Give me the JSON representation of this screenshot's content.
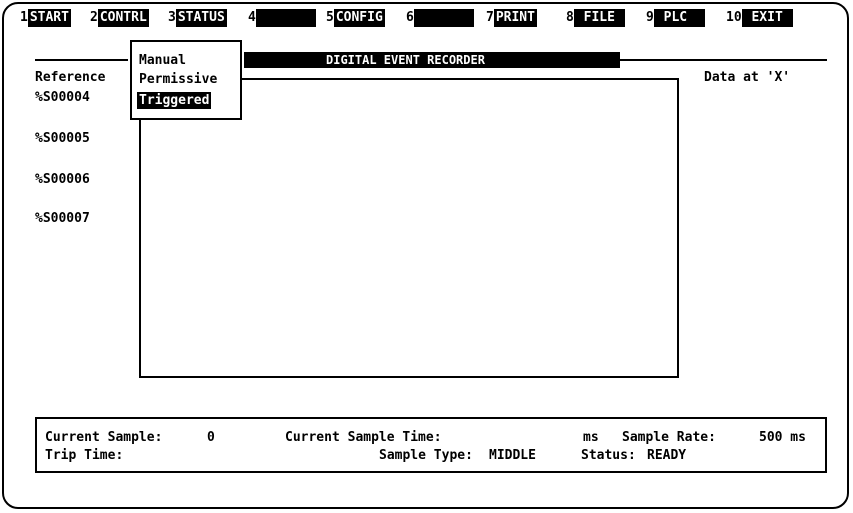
{
  "fkeys": [
    {
      "num": "1",
      "label": "START"
    },
    {
      "num": "2",
      "label": "CONTRL"
    },
    {
      "num": "3",
      "label": "STATUS"
    },
    {
      "num": "4",
      "label": "      "
    },
    {
      "num": "5",
      "label": "CONFIG"
    },
    {
      "num": "6",
      "label": "      "
    },
    {
      "num": "7",
      "label": "PRINT"
    },
    {
      "num": "8",
      "label": " FILE "
    },
    {
      "num": "9",
      "label": " PLC  "
    },
    {
      "num": "10",
      "label": " EXIT "
    }
  ],
  "title": "DIGITAL EVENT RECORDER",
  "reference_header": "Reference",
  "data_header": "Data at 'X'",
  "references": [
    "%S00004",
    "%S00005",
    "%S00006",
    "%S00007"
  ],
  "menu": {
    "items": [
      "Manual",
      "Permissive",
      "Triggered"
    ],
    "selected": "Triggered"
  },
  "status": {
    "current_sample_label": "Current Sample:",
    "current_sample_value": "0",
    "current_sample_time_label": "Current Sample Time:",
    "current_sample_time_unit": "ms",
    "sample_rate_label": "Sample Rate:",
    "sample_rate_value": "500 ms",
    "trip_time_label": "Trip Time:",
    "sample_type_label": "Sample Type:",
    "sample_type_value": "MIDDLE",
    "status_label": "Status:",
    "status_value": "READY"
  }
}
